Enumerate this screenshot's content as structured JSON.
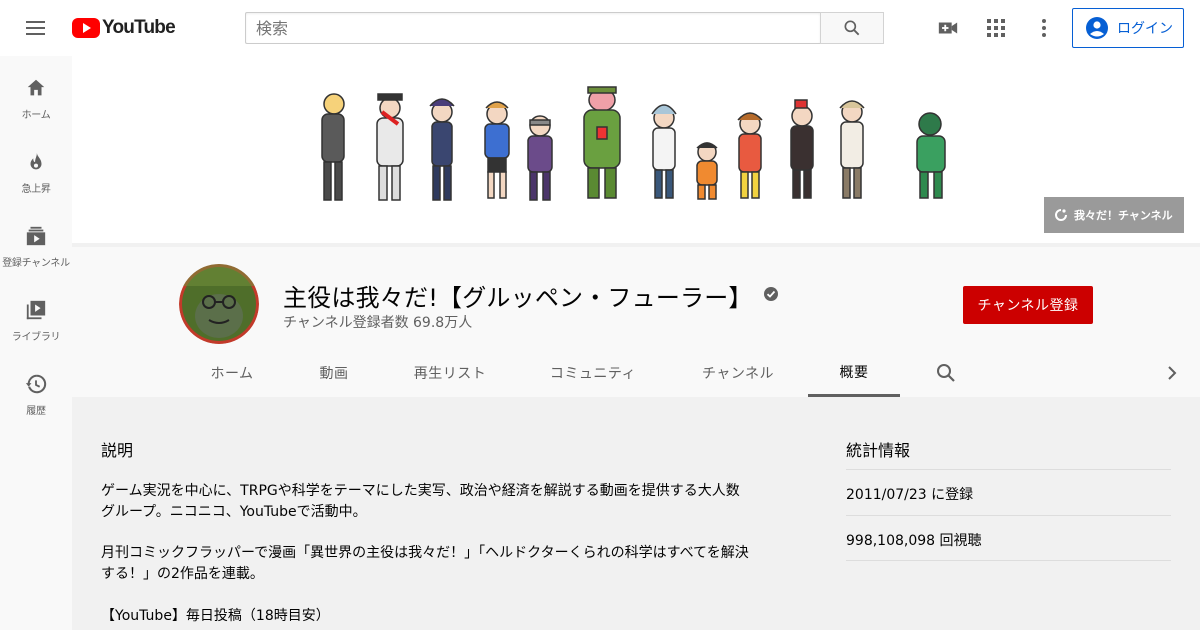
{
  "masthead": {
    "logo_text": "YouTube",
    "search_placeholder": "検索",
    "login_label": "ログイン"
  },
  "guide": {
    "items": [
      {
        "label": "ホーム",
        "icon": "home-icon"
      },
      {
        "label": "急上昇",
        "icon": "fire-icon"
      },
      {
        "label": "登録チャンネル",
        "icon": "subscriptions-icon"
      },
      {
        "label": "ライブラリ",
        "icon": "library-icon"
      },
      {
        "label": "履歴",
        "icon": "history-icon"
      }
    ]
  },
  "banner": {
    "link_label": "我々だ！チャンネル"
  },
  "channel": {
    "title": "主役は我々だ!【グルッペン・フューラー】",
    "subscribers": "チャンネル登録者数 69.8万人",
    "subscribe_label": "チャンネル登録",
    "tabs": [
      {
        "label": "ホーム"
      },
      {
        "label": "動画"
      },
      {
        "label": "再生リスト"
      },
      {
        "label": "コミュニティ"
      },
      {
        "label": "チャンネル"
      },
      {
        "label": "概要"
      }
    ],
    "active_tab": "概要"
  },
  "about": {
    "description_heading": "説明",
    "paragraphs": [
      "ゲーム実況を中心に、TRPGや科学をテーマにした実写、政治や経済を解説する動画を提供する大人数グループ。ニコニコ、YouTubeで活動中。",
      "月刊コミックフラッパーで漫画「異世界の主役は我々だ！」「ヘルドクターくられの科学はすべてを解決する！」の2作品を連載。",
      "【YouTube】毎日投稿（18時目安）"
    ],
    "stats_heading": "統計情報",
    "joined": "2011/07/23 に登録",
    "views": "998,108,098 回視聴"
  },
  "colors": {
    "brand_red": "#ff0000",
    "subscribe_red": "#cc0000",
    "link_blue": "#065fd4"
  }
}
